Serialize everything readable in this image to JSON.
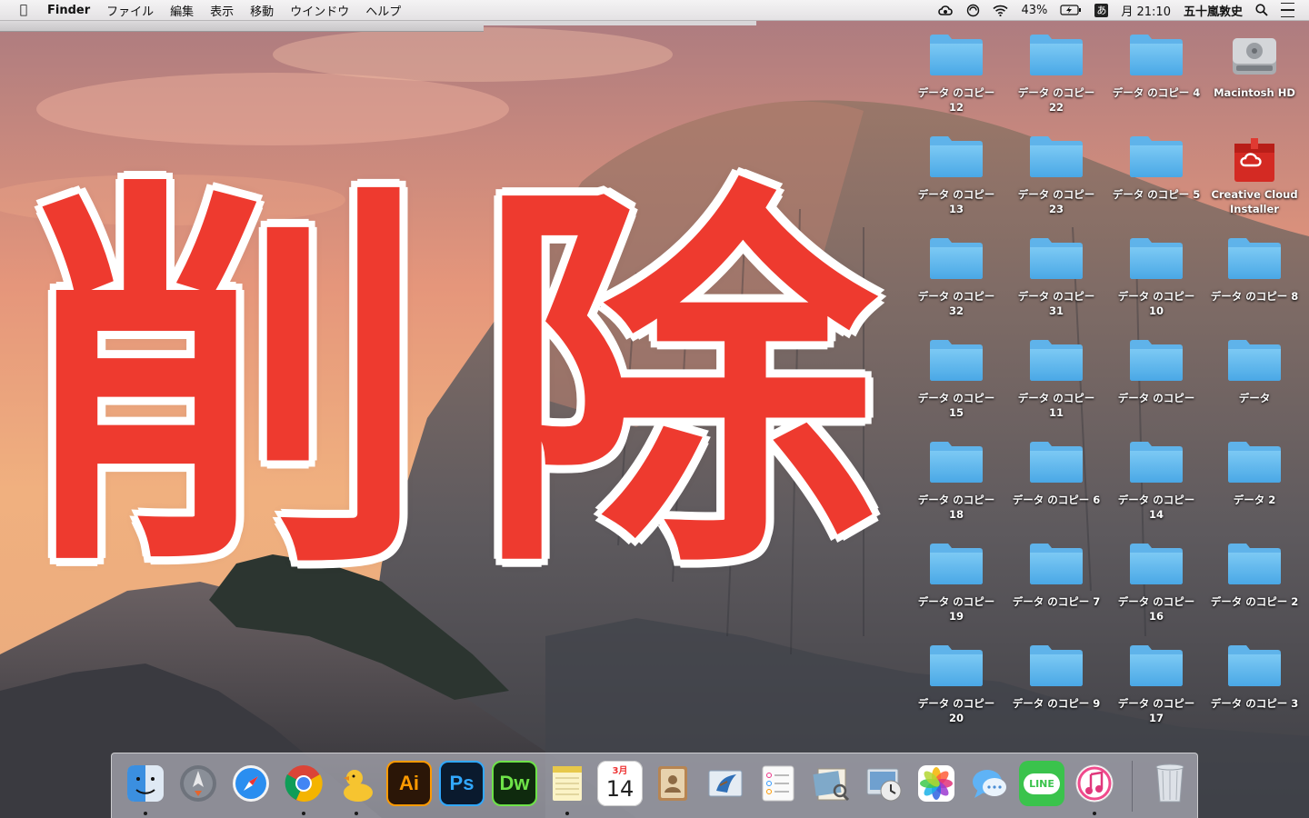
{
  "menubar": {
    "apple_icon": "apple-icon",
    "app_name": "Finder",
    "menus": [
      "ファイル",
      "編集",
      "表示",
      "移動",
      "ウインドウ",
      "ヘルプ"
    ],
    "battery": "43%",
    "ime": "あ",
    "clock": "月 21:10",
    "user": "五十嵐敦史"
  },
  "overlay": {
    "char1": "削",
    "char2": "除",
    "color": "#ee3a2f"
  },
  "desktop": {
    "columns": [
      [
        {
          "l1": "データ のコピー",
          "l2": "12",
          "type": "folder"
        },
        {
          "l1": "データ のコピー",
          "l2": "13",
          "type": "folder"
        },
        {
          "l1": "データ のコピー",
          "l2": "32",
          "type": "folder"
        },
        {
          "l1": "データ のコピー",
          "l2": "15",
          "type": "folder"
        },
        {
          "l1": "データ のコピー",
          "l2": "18",
          "type": "folder"
        },
        {
          "l1": "データ のコピー",
          "l2": "19",
          "type": "folder"
        },
        {
          "l1": "データ のコピー",
          "l2": "20",
          "type": "folder"
        }
      ],
      [
        {
          "l1": "データ のコピー",
          "l2": "22",
          "type": "folder"
        },
        {
          "l1": "データ のコピー",
          "l2": "23",
          "type": "folder"
        },
        {
          "l1": "データ のコピー",
          "l2": "31",
          "type": "folder"
        },
        {
          "l1": "データ のコピー",
          "l2": "11",
          "type": "folder"
        },
        {
          "l1": "データ のコピー 6",
          "l2": "",
          "type": "folder"
        },
        {
          "l1": "データ のコピー 7",
          "l2": "",
          "type": "folder"
        },
        {
          "l1": "データ のコピー 9",
          "l2": "",
          "type": "folder"
        }
      ],
      [
        {
          "l1": "データ のコピー 4",
          "l2": "",
          "type": "folder"
        },
        {
          "l1": "データ のコピー 5",
          "l2": "",
          "type": "folder"
        },
        {
          "l1": "データ のコピー",
          "l2": "10",
          "type": "folder"
        },
        {
          "l1": "データ のコピー",
          "l2": "",
          "type": "folder"
        },
        {
          "l1": "データ のコピー",
          "l2": "14",
          "type": "folder"
        },
        {
          "l1": "データ のコピー",
          "l2": "16",
          "type": "folder"
        },
        {
          "l1": "データ のコピー",
          "l2": "17",
          "type": "folder"
        }
      ],
      [
        {
          "l1": "Macintosh HD",
          "l2": "",
          "type": "disk"
        },
        {
          "l1": "Creative Cloud",
          "l2": "Installer",
          "type": "cc"
        },
        {
          "l1": "データ のコピー 8",
          "l2": "",
          "type": "folder"
        },
        {
          "l1": "データ",
          "l2": "",
          "type": "folder"
        },
        {
          "l1": "データ 2",
          "l2": "",
          "type": "folder"
        },
        {
          "l1": "データ のコピー 2",
          "l2": "",
          "type": "folder"
        },
        {
          "l1": "データ のコピー 3",
          "l2": "",
          "type": "folder"
        }
      ]
    ]
  },
  "dock": {
    "items": [
      {
        "id": "finder",
        "label": "",
        "icon": "finder-icon",
        "bg": "#4fa3e6",
        "running": true
      },
      {
        "id": "launchpad",
        "label": "",
        "icon": "launchpad-icon",
        "bg": "#5a5d66",
        "running": false
      },
      {
        "id": "safari",
        "label": "",
        "icon": "safari-icon",
        "bg": "#2d8de8",
        "running": false
      },
      {
        "id": "chrome",
        "label": "",
        "icon": "chrome-icon",
        "bg": "#e0e0e0",
        "running": true
      },
      {
        "id": "cyberduck",
        "label": "",
        "icon": "duck-icon",
        "bg": "#f5c631",
        "running": true
      },
      {
        "id": "illustrator",
        "label": "Ai",
        "icon": "illustrator-icon",
        "bg": "#2b1607",
        "fg": "#ff9a00",
        "running": false
      },
      {
        "id": "photoshop",
        "label": "Ps",
        "icon": "photoshop-icon",
        "bg": "#0a1a2e",
        "fg": "#31a8ff",
        "running": false
      },
      {
        "id": "dreamweaver",
        "label": "Dw",
        "icon": "dreamweaver-icon",
        "bg": "#0f2a0e",
        "fg": "#6ee348",
        "running": false
      },
      {
        "id": "notes",
        "label": "",
        "icon": "notes-icon",
        "bg": "#f6e27a",
        "running": true
      },
      {
        "id": "calendar",
        "label": "14",
        "month": "3月",
        "icon": "calendar-icon",
        "bg": "#ffffff",
        "running": false
      },
      {
        "id": "contacts",
        "label": "",
        "icon": "contacts-icon",
        "bg": "#a97846",
        "running": false
      },
      {
        "id": "mail",
        "label": "",
        "icon": "mail-icon",
        "bg": "#dfe6ee",
        "running": false
      },
      {
        "id": "reminders",
        "label": "",
        "icon": "reminders-icon",
        "bg": "#fafafa",
        "running": false
      },
      {
        "id": "preview",
        "label": "",
        "icon": "preview-icon",
        "bg": "#c7c0b0",
        "running": false
      },
      {
        "id": "timemachine",
        "label": "",
        "icon": "time-machine-icon",
        "bg": "#d8dde2",
        "running": false
      },
      {
        "id": "photos",
        "label": "",
        "icon": "photos-icon",
        "bg": "#ffffff",
        "running": false
      },
      {
        "id": "messages",
        "label": "",
        "icon": "messages-icon",
        "bg": "#56a9f3",
        "running": false
      },
      {
        "id": "line",
        "label": "LINE",
        "icon": "line-icon",
        "bg": "#3ac34c",
        "running": false
      },
      {
        "id": "itunes",
        "label": "",
        "icon": "itunes-icon",
        "bg": "#fff",
        "running": true
      }
    ],
    "trash": {
      "id": "trash",
      "icon": "trash-icon"
    }
  }
}
